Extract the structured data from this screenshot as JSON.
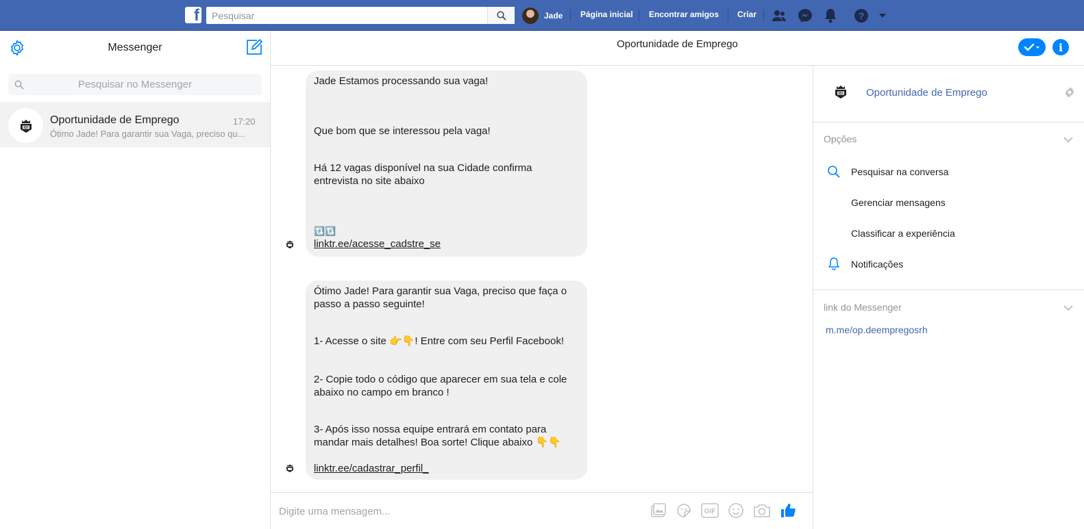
{
  "topbar": {
    "logo_letter": "f",
    "search_placeholder": "Pesquisar",
    "user_name": "Jade",
    "nav": [
      "Página inicial",
      "Encontrar amigos",
      "Criar"
    ],
    "icons": [
      "friends-icon",
      "messenger-icon",
      "bell-icon",
      "help-icon",
      "dropdown-caret-icon"
    ]
  },
  "sidebar": {
    "title": "Messenger",
    "search_placeholder": "Pesquisar no Messenger",
    "conversations": [
      {
        "name": "Oportunidade de Emprego",
        "time": "17:20",
        "preview": "Ótimo Jade! Para garantir sua Vaga, preciso qu..."
      }
    ]
  },
  "chat": {
    "title": "Oportunidade de Emprego",
    "messages": [
      {
        "lines": [
          "Jade Estamos processando sua vaga!",
          "Que bom que se interessou pela vaga!",
          "Há 12 vagas disponível na sua Cidade confirma entrevista no site abaixo"
        ],
        "emoji": "🔃🔃",
        "link": "linktr.ee/acesse_cadstre_se"
      },
      {
        "lines": [
          "Ótimo Jade! Para garantir sua Vaga, preciso que faça o passo a passo seguinte!",
          "1- Acesse o site 👉👇! Entre com seu Perfil Facebook!",
          "2- Copie todo o código que aparecer em sua tela e cole abaixo no campo em branco !",
          "3- Após isso nossa equipe entrará em contato para mandar mais detalhes! Boa sorte! Clique abaixo 👇👇"
        ],
        "link": "linktr.ee/cadastrar_perfil_"
      }
    ],
    "composer_placeholder": "Digite uma mensagem...",
    "composer_icons": [
      "image-icon",
      "sticker-icon",
      "gif-icon",
      "emoji-icon",
      "camera-icon",
      "like-icon"
    ]
  },
  "panel": {
    "name": "Oportunidade de Emprego",
    "options_title": "Opções",
    "options": [
      "Pesquisar na conversa",
      "Gerenciar mensagens",
      "Classificar a experiência",
      "Notificações"
    ],
    "link_section_title": "link do Messenger",
    "link": "m.me/op.deempregosrh"
  },
  "colors": {
    "brand": "#4267b2",
    "accent": "#0084ff",
    "bubble": "#f0f0f0"
  }
}
